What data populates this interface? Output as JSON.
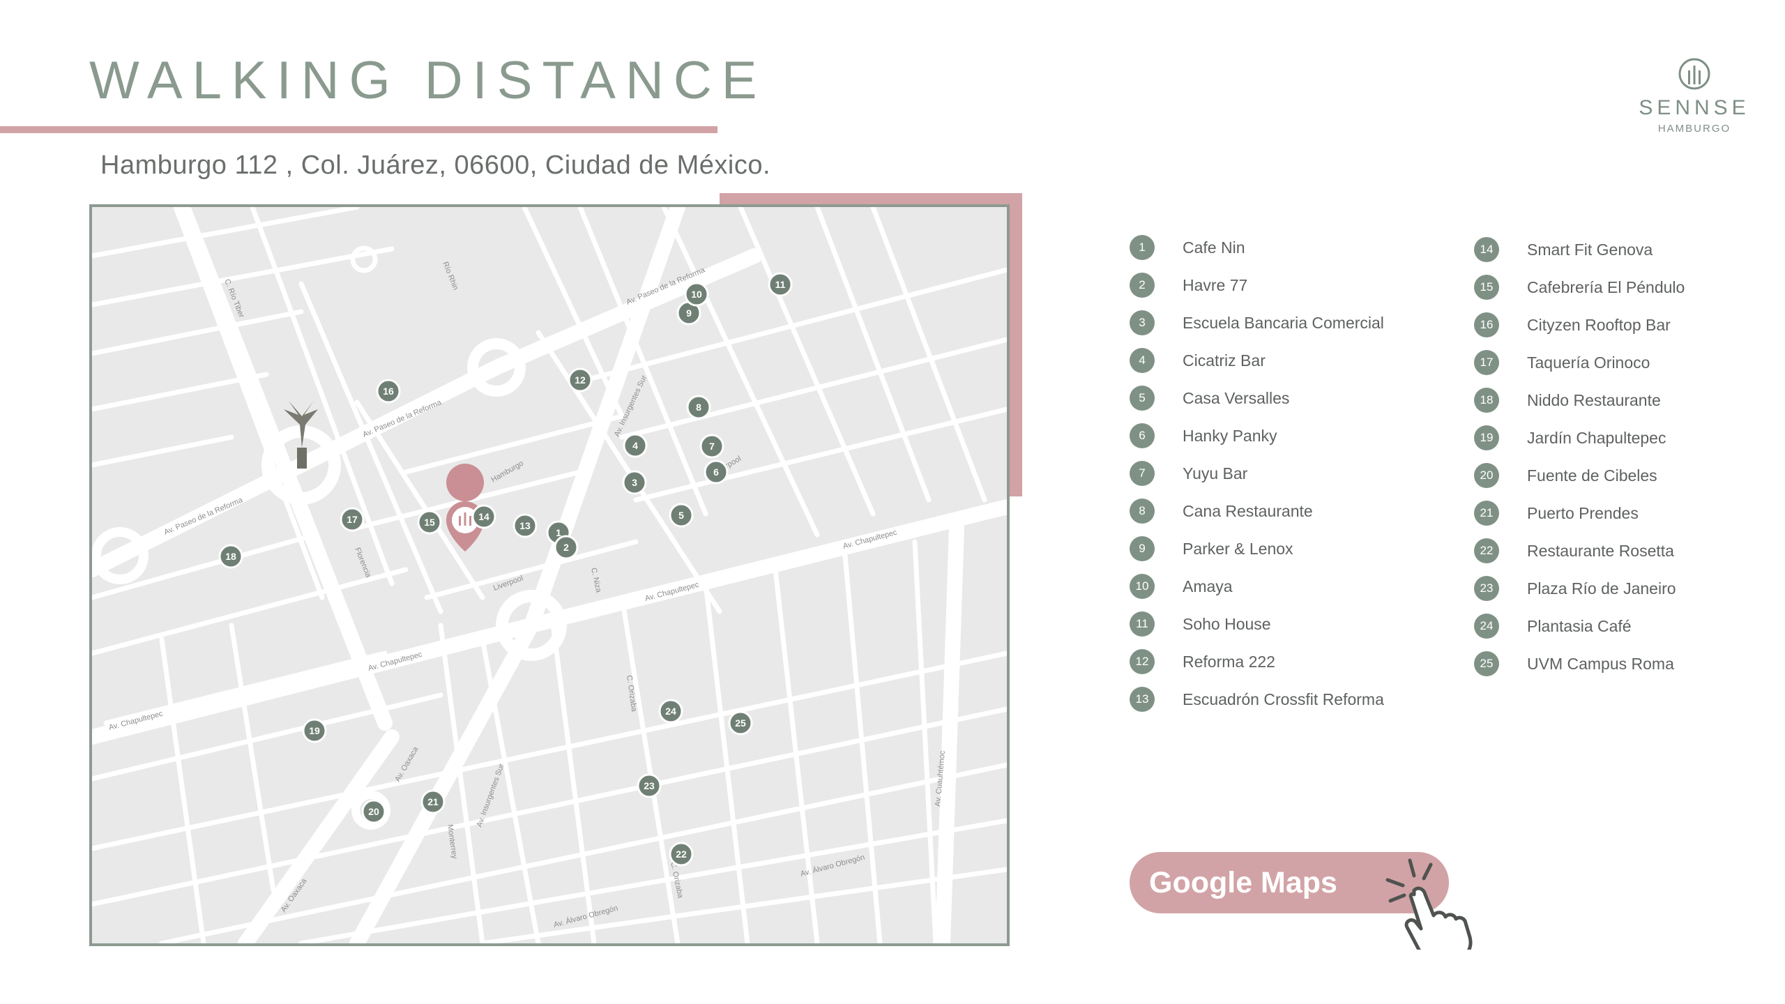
{
  "header": {
    "title": "WALKING DISTANCE",
    "address": "Hamburgo 112 , Col. Juárez, 06600, Ciudad de México."
  },
  "logo": {
    "name": "SENNSE",
    "subtitle": "HAMBURGO",
    "icon": "building-columns-icon"
  },
  "colors": {
    "accent_pink": "#d2a3a6",
    "sage": "#7f9185",
    "title_green": "#8a9a8e",
    "map_bg": "#e9e9e9"
  },
  "map": {
    "home_marker": "location-pin-icon",
    "streets": [
      "C. Río Tiber",
      "Río Rhin",
      "Av. Paseo de la Reforma",
      "Av. Paseo de la Reforma",
      "Av. Paseo de la Reforma",
      "Hamburgo",
      "Av. Insurgentes Sur",
      "Liverpool",
      "Liverpool",
      "Florencia",
      "C. Niza",
      "Av. Chapultepec",
      "Av. Chapultepec",
      "Av. Chapultepec",
      "Av. Chapultepec",
      "C. Orizaba",
      "Av. Oaxaca",
      "Av. Insurgentes Sur",
      "Monterrey",
      "Av. Oaxaca",
      "C. Orizaba",
      "Av. Álvaro Obregón",
      "Av. Álvaro Obregón",
      "Av. Cuauhtémoc"
    ],
    "pins": [
      "1",
      "2",
      "3",
      "4",
      "5",
      "6",
      "7",
      "8",
      "9",
      "10",
      "11",
      "12",
      "13",
      "14",
      "15",
      "16",
      "17",
      "18",
      "19",
      "20",
      "21",
      "22",
      "23",
      "24",
      "25"
    ]
  },
  "places_left": [
    {
      "n": "1",
      "name": "Cafe Nin"
    },
    {
      "n": "2",
      "name": "Havre 77"
    },
    {
      "n": "3",
      "name": "Escuela Bancaria Comercial"
    },
    {
      "n": "4",
      "name": "Cicatriz Bar"
    },
    {
      "n": "5",
      "name": "Casa Versalles"
    },
    {
      "n": "6",
      "name": "Hanky Panky"
    },
    {
      "n": "7",
      "name": "Yuyu Bar"
    },
    {
      "n": "8",
      "name": "Cana Restaurante"
    },
    {
      "n": "9",
      "name": "Parker & Lenox"
    },
    {
      "n": "10",
      "name": "Amaya"
    },
    {
      "n": "11",
      "name": "Soho House"
    },
    {
      "n": "12",
      "name": "Reforma 222"
    },
    {
      "n": "13",
      "name": "Escuadrón Crossfit Reforma"
    }
  ],
  "places_right": [
    {
      "n": "14",
      "name": "Smart Fit Genova"
    },
    {
      "n": "15",
      "name": "Cafebrería El Péndulo"
    },
    {
      "n": "16",
      "name": "Cityzen Rooftop Bar"
    },
    {
      "n": "17",
      "name": "Taquería Orinoco"
    },
    {
      "n": "18",
      "name": "Niddo Restaurante"
    },
    {
      "n": "19",
      "name": "Jardín Chapultepec"
    },
    {
      "n": "20",
      "name": "Fuente de Cibeles"
    },
    {
      "n": "21",
      "name": "Puerto Prendes"
    },
    {
      "n": "22",
      "name": "Restaurante Rosetta"
    },
    {
      "n": "23",
      "name": "Plaza Río de Janeiro"
    },
    {
      "n": "24",
      "name": "Plantasia Café"
    },
    {
      "n": "25",
      "name": "UVM Campus Roma"
    }
  ],
  "cta": {
    "label": "Google Maps",
    "icon": "pointing-hand-click-icon"
  }
}
